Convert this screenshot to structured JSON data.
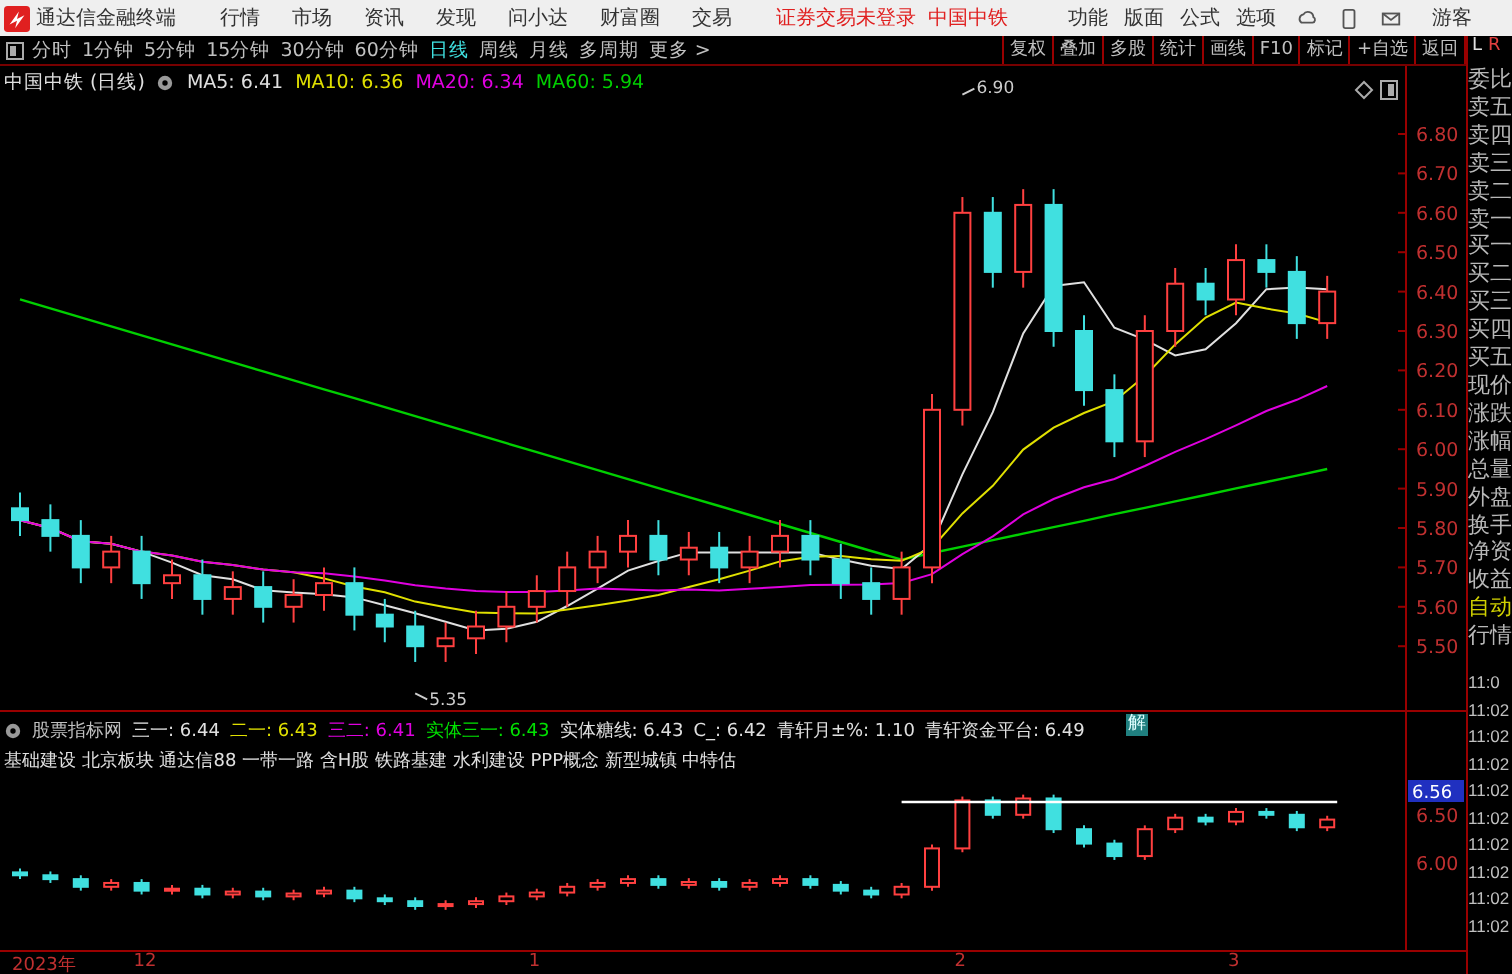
{
  "menubar": {
    "app_title": "通达信金融终端",
    "menus": [
      "行情",
      "市场",
      "资讯",
      "发现",
      "问小达",
      "财富圈",
      "交易"
    ],
    "notice": [
      "证券交易未登录",
      "中国中铁"
    ],
    "tools": [
      "功能",
      "版面",
      "公式",
      "选项"
    ],
    "user": "游客"
  },
  "period_tabs": [
    {
      "label": "分时",
      "selected": false
    },
    {
      "label": "1分钟",
      "selected": false
    },
    {
      "label": "5分钟",
      "selected": false
    },
    {
      "label": "15分钟",
      "selected": false
    },
    {
      "label": "30分钟",
      "selected": false
    },
    {
      "label": "60分钟",
      "selected": false
    },
    {
      "label": "日线",
      "selected": true
    },
    {
      "label": "周线",
      "selected": false
    },
    {
      "label": "月线",
      "selected": false
    },
    {
      "label": "多周期",
      "selected": false
    },
    {
      "label": "更多 >",
      "selected": false
    }
  ],
  "chart_buttons": [
    "复权",
    "叠加",
    "多股",
    "统计",
    "画线",
    "F10",
    "标记",
    "+自选",
    "返回"
  ],
  "main_legend": {
    "title": "中国中铁 (日线)",
    "items": [
      {
        "text": "MA5: 6.41",
        "color": "#e0e0e0"
      },
      {
        "text": "MA10: 6.36",
        "color": "#e0e000"
      },
      {
        "text": "MA20: 6.34",
        "color": "#e000e0"
      },
      {
        "text": "MA60: 5.94",
        "color": "#00d000"
      }
    ]
  },
  "main_chart": {
    "price_ticks": [
      "6.80",
      "6.70",
      "6.60",
      "6.50",
      "6.40",
      "6.30",
      "6.20",
      "6.10",
      "6.00",
      "5.90",
      "5.80",
      "5.70",
      "5.60",
      "5.50"
    ],
    "high_label": "6.90",
    "low_label": "5.35"
  },
  "lower_legend": {
    "items": [
      {
        "text": "股票指标网",
        "color": "#c0c0c0"
      },
      {
        "text": "三一: 6.44",
        "color": "#e0e0e0"
      },
      {
        "text": "二一: 6.43",
        "color": "#e0e000"
      },
      {
        "text": "三二: 6.41",
        "color": "#e000e0"
      },
      {
        "text": "实体三一: 6.43",
        "color": "#00e000"
      },
      {
        "text": "实体糖线: 6.43",
        "color": "#e0e0e0"
      },
      {
        "text": "C_: 6.42",
        "color": "#e0e0e0"
      },
      {
        "text": "青轩月±%: 1.10",
        "color": "#e0e0e0"
      },
      {
        "text": "青轩资金平台: 6.49",
        "color": "#e0e0e0"
      }
    ],
    "concepts": "基础建设 北京板块 通达信88 一带一路 含H股 铁路基建 水利建设 PPP概念 新型城镇 中特估",
    "marker": "解"
  },
  "lower_chart": {
    "price_ticks": [
      "6.50",
      "6.00"
    ],
    "current_price": "6.56"
  },
  "date_axis": [
    "2023年",
    "12",
    "1",
    "2",
    "3"
  ],
  "side_panel": {
    "header": [
      {
        "text": "L",
        "selected": true
      },
      {
        "text": "R",
        "selected": false
      }
    ],
    "labels": [
      {
        "text": "委比",
        "highlighted": false
      },
      {
        "text": "卖五",
        "highlighted": false
      },
      {
        "text": "卖四",
        "highlighted": false
      },
      {
        "text": "卖三",
        "highlighted": false
      },
      {
        "text": "卖二",
        "highlighted": false
      },
      {
        "text": "卖一",
        "highlighted": false
      },
      {
        "text": "买一",
        "highlighted": false
      },
      {
        "text": "买二",
        "highlighted": false
      },
      {
        "text": "买三",
        "highlighted": false
      },
      {
        "text": "买四",
        "highlighted": false
      },
      {
        "text": "买五",
        "highlighted": false
      },
      {
        "text": "现价",
        "highlighted": false
      },
      {
        "text": "涨跌",
        "highlighted": false
      },
      {
        "text": "涨幅",
        "highlighted": false
      },
      {
        "text": "总量",
        "highlighted": false
      },
      {
        "text": "外盘",
        "highlighted": false
      },
      {
        "text": "换手",
        "highlighted": false
      },
      {
        "text": "净资",
        "highlighted": false
      },
      {
        "text": "收益",
        "highlighted": false
      },
      {
        "text": "自动",
        "highlighted": true
      },
      {
        "text": "行情",
        "highlighted": false
      }
    ],
    "times": [
      "11:0",
      "11:02",
      "11:02",
      "11:02",
      "11:02",
      "11:02",
      "11:02",
      "11:02",
      "11:02",
      "11:02"
    ]
  }
}
